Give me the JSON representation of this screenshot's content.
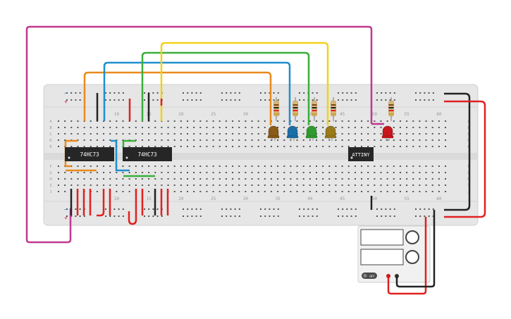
{
  "breadboard": {
    "col_numbers_top": [
      "10",
      "15",
      "20",
      "25",
      "30",
      "35",
      "40",
      "45",
      "50",
      "55",
      "60"
    ],
    "col_numbers_bottom": [
      "10",
      "15",
      "20",
      "25",
      "30",
      "35",
      "40",
      "45",
      "50",
      "55",
      "60"
    ],
    "row_letters_top": [
      "A",
      "B",
      "C",
      "D",
      "E"
    ],
    "row_letters_bottom": [
      "F",
      "G",
      "H",
      "I",
      "J"
    ],
    "rail_plus": "+",
    "rail_minus": "−"
  },
  "chips": [
    {
      "label": "74HC73"
    },
    {
      "label": "74HC73"
    },
    {
      "label": "ATTINY"
    }
  ],
  "leds": [
    {
      "color": "#8a5a17"
    },
    {
      "color": "#1b6fa8"
    },
    {
      "color": "#2e9b2e"
    },
    {
      "color": "#9a7a1a"
    },
    {
      "color": "#c8161d"
    }
  ],
  "wire_colors": {
    "magenta": "#c0398f",
    "orange": "#e98a1d",
    "blue": "#1f8fcf",
    "green": "#3aae3a",
    "yellow": "#f2d21b",
    "red": "#e0211f",
    "black": "#222222"
  },
  "power_supply": {
    "button_label": "OFF"
  }
}
